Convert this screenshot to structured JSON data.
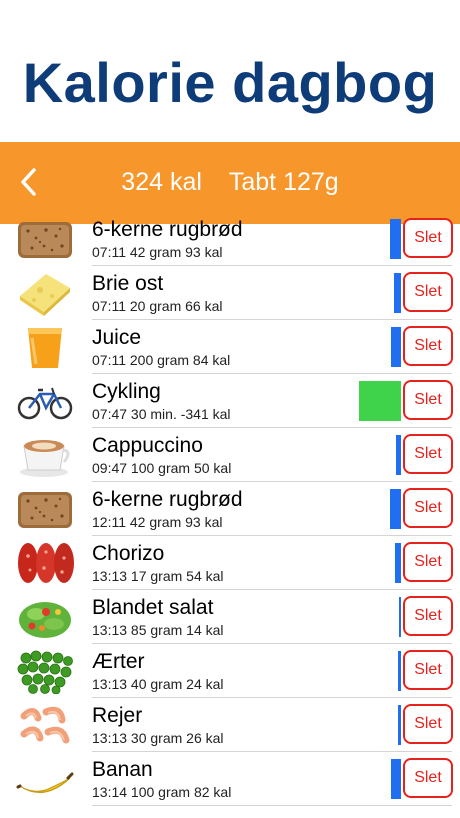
{
  "header": {
    "title": "Kalorie dagbog"
  },
  "summary": {
    "calories": "324 kal",
    "lost": "Tabt 127g"
  },
  "actions": {
    "delete_label": "Slet"
  },
  "colors": {
    "accent_bar": "#f7962a",
    "title": "#0d3c78",
    "level_bar": "#1f6ff0",
    "exercise_level": "#3fd34b",
    "delete": "#e5221c"
  },
  "entries": [
    {
      "name": "6-kerne rugbrød",
      "detail": "07:11 42 gram 93 kal",
      "icon": "rye-bread-icon",
      "level": 0.9,
      "level_color": "#1f6ff0"
    },
    {
      "name": "Brie ost",
      "detail": "07:11 20 gram 66 kal",
      "icon": "cheese-icon",
      "level": 0.62,
      "level_color": "#1f6ff0"
    },
    {
      "name": "Juice",
      "detail": "07:11 200 gram 84 kal",
      "icon": "juice-icon",
      "level": 0.8,
      "level_color": "#1f6ff0"
    },
    {
      "name": "Cykling",
      "detail": "07:47 30 min. -341 kal",
      "icon": "bicycle-icon",
      "level": 1.0,
      "level_color": "#3fd34b"
    },
    {
      "name": "Cappuccino",
      "detail": "09:47 100 gram 50 kal",
      "icon": "cappuccino-icon",
      "level": 0.45,
      "level_color": "#1f6ff0"
    },
    {
      "name": "6-kerne rugbrød",
      "detail": "12:11 42 gram 93 kal",
      "icon": "rye-bread-icon",
      "level": 0.9,
      "level_color": "#1f6ff0"
    },
    {
      "name": "Chorizo",
      "detail": "13:13 17 gram 54 kal",
      "icon": "chorizo-icon",
      "level": 0.5,
      "level_color": "#1f6ff0"
    },
    {
      "name": "Blandet salat",
      "detail": "13:13 85 gram 14 kal",
      "icon": "salad-icon",
      "level": 0.13,
      "level_color": "#1f6ff0"
    },
    {
      "name": "Ærter",
      "detail": "13:13 40 gram 24 kal",
      "icon": "peas-icon",
      "level": 0.22,
      "level_color": "#1f6ff0"
    },
    {
      "name": "Rejer",
      "detail": "13:13 30 gram 26 kal",
      "icon": "shrimp-icon",
      "level": 0.24,
      "level_color": "#1f6ff0"
    },
    {
      "name": "Banan",
      "detail": "13:14 100 gram 82 kal",
      "icon": "banana-icon",
      "level": 0.8,
      "level_color": "#1f6ff0"
    }
  ]
}
